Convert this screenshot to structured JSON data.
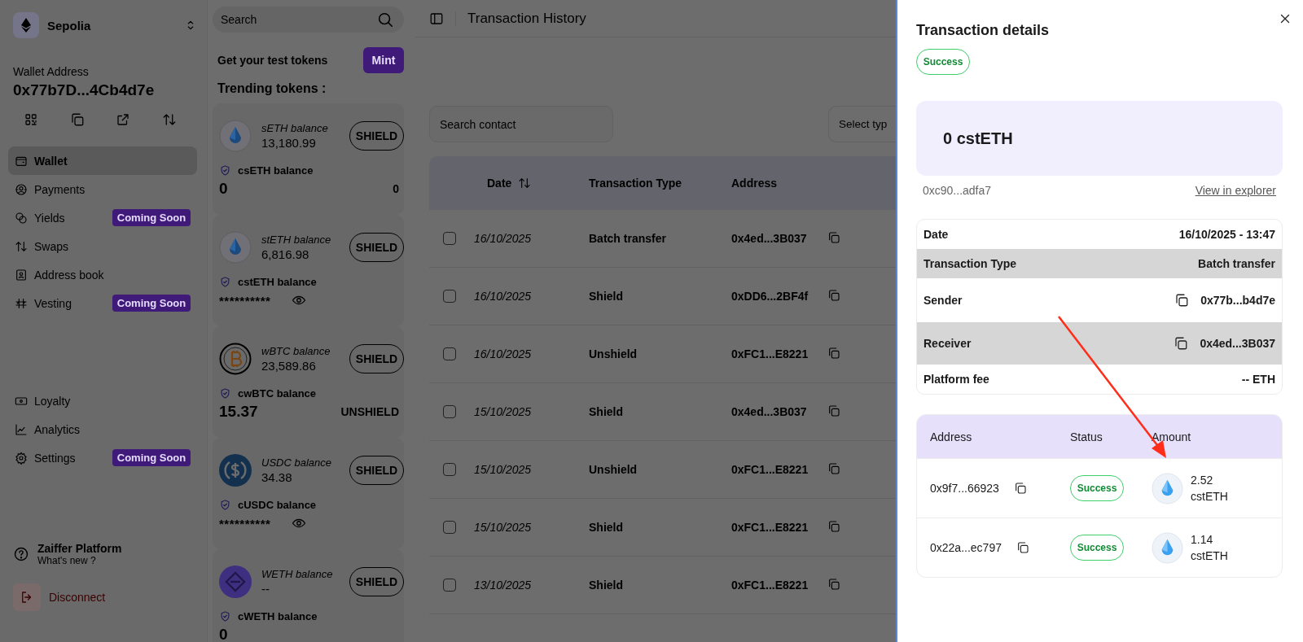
{
  "sidebar": {
    "network": "Sepolia",
    "wallet_label": "Wallet Address",
    "wallet_address": "0x77b7D...4Cb4d7e",
    "nav": [
      {
        "label": "Wallet",
        "selected": true
      },
      {
        "label": "Payments",
        "selected": false
      },
      {
        "label": "Yields",
        "selected": false,
        "badge": "Coming Soon"
      },
      {
        "label": "Swaps",
        "selected": false
      },
      {
        "label": "Address book",
        "selected": false
      },
      {
        "label": "Vesting",
        "selected": false,
        "badge": "Coming Soon"
      }
    ],
    "lower_nav": [
      {
        "label": "Loyalty",
        "selected": false
      },
      {
        "label": "Analytics",
        "selected": false
      },
      {
        "label": "Settings",
        "selected": false,
        "badge": "Coming Soon"
      }
    ],
    "help": {
      "title": "Zaiffer Platform",
      "subtitle": "What's new ?"
    },
    "disconnect": "Disconnect"
  },
  "tokens": {
    "search_placeholder": "Search",
    "test_tokens_label": "Get your test tokens",
    "mint_button": "Mint",
    "trending_title": "Trending tokens :",
    "items": [
      {
        "name": "sETH balance",
        "balance": "13,180.99",
        "action": "SHIELD",
        "private_name": "csETH balance",
        "private_balance": "0",
        "private_side": "0",
        "hidden": false
      },
      {
        "name": "stETH balance",
        "balance": "6,816.98",
        "action": "SHIELD",
        "private_name": "cstETH balance",
        "private_balance": "**********",
        "hidden": true
      },
      {
        "name": "wBTC balance",
        "balance": "23,589.86",
        "action": "SHIELD",
        "private_name": "cwBTC balance",
        "private_balance": "15.37",
        "private_side": "UNSHIELD",
        "hidden": false
      },
      {
        "name": "USDC balance",
        "balance": "34.38",
        "action": "SHIELD",
        "private_name": "cUSDC balance",
        "private_balance": "**********",
        "hidden": true
      },
      {
        "name": "WETH balance",
        "balance": "--",
        "action": "SHIELD",
        "private_name": "cWETH balance",
        "private_balance": "0",
        "hidden": false
      }
    ]
  },
  "main": {
    "title": "Transaction History",
    "search_placeholder": "Search contact",
    "type_filter": "Select typ",
    "table": {
      "columns": [
        "Date",
        "Transaction Type",
        "Address"
      ],
      "rows": [
        {
          "date": "16/10/2025",
          "type": "Batch transfer",
          "address": "0x4ed...3B037",
          "checked": false
        },
        {
          "date": "16/10/2025",
          "type": "Shield",
          "address": "0xDD6...2BF4f",
          "checked": false
        },
        {
          "date": "16/10/2025",
          "type": "Unshield",
          "address": "0xFC1...E8221",
          "checked": false
        },
        {
          "date": "15/10/2025",
          "type": "Shield",
          "address": "0x4ed...3B037",
          "checked": false
        },
        {
          "date": "15/10/2025",
          "type": "Unshield",
          "address": "0xFC1...E8221",
          "checked": false
        },
        {
          "date": "15/10/2025",
          "type": "Shield",
          "address": "0xFC1...E8221",
          "checked": false
        },
        {
          "date": "13/10/2025",
          "type": "Shield",
          "address": "0xFC1...E8221",
          "checked": false
        }
      ]
    }
  },
  "drawer": {
    "title": "Transaction details",
    "status": "Success",
    "amount": "0 cstETH",
    "hash": "0xc90...adfa7",
    "explorer_link": "View in explorer",
    "details": [
      {
        "label": "Date",
        "value": "16/10/2025 - 13:47",
        "highlighted": false,
        "copyable": false
      },
      {
        "label": "Transaction Type",
        "value": "Batch transfer",
        "highlighted": true,
        "copyable": false
      },
      {
        "label": "Sender",
        "value": "0x77b...b4d7e",
        "highlighted": false,
        "copyable": true
      },
      {
        "label": "Receiver",
        "value": "0x4ed...3B037",
        "highlighted": true,
        "copyable": true
      },
      {
        "label": "Platform fee",
        "value": "-- ETH",
        "highlighted": false,
        "copyable": false
      }
    ],
    "recipients": {
      "columns": [
        "Address",
        "Status",
        "Amount"
      ],
      "rows": [
        {
          "address": "0x9f7...66923",
          "status": "Success",
          "amount": "2.52 cstETH"
        },
        {
          "address": "0x22a...ec797",
          "status": "Success",
          "amount": "1.14 cstETH"
        }
      ]
    }
  }
}
